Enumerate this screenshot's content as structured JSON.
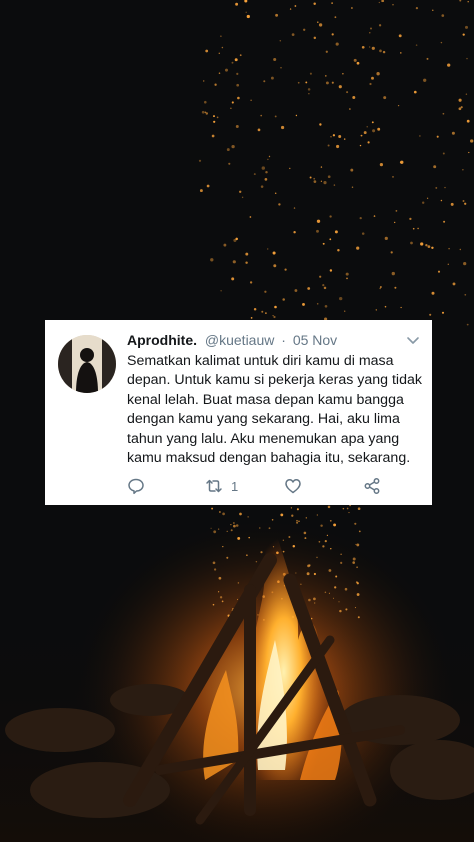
{
  "tweet": {
    "display_name": "Aprodhite.",
    "handle": "@kuetiauw",
    "separator": "·",
    "date": "05 Nov",
    "text_lines": [
      "Sematkan kalimat untuk diri kamu di masa",
      "depan. Untuk kamu si pekerja keras yang tidak",
      "kenal lelah. Buat masa depan kamu bangga",
      "dengan kamu yang sekarang. Hai, aku lima",
      "tahun yang lalu. Aku menemukan apa yang",
      "kamu maksud dengan bahagia itu, sekarang."
    ],
    "retweet_count": "1"
  },
  "icons": [
    "chevron-down-icon",
    "reply-icon",
    "retweet-icon",
    "like-icon",
    "share-icon"
  ],
  "colors": {
    "card_background": "#ffffff",
    "text_primary": "#14171a",
    "text_secondary": "#657786",
    "icon": "#657786",
    "background": "#0b0c0d",
    "fire": "#f28a1e"
  }
}
